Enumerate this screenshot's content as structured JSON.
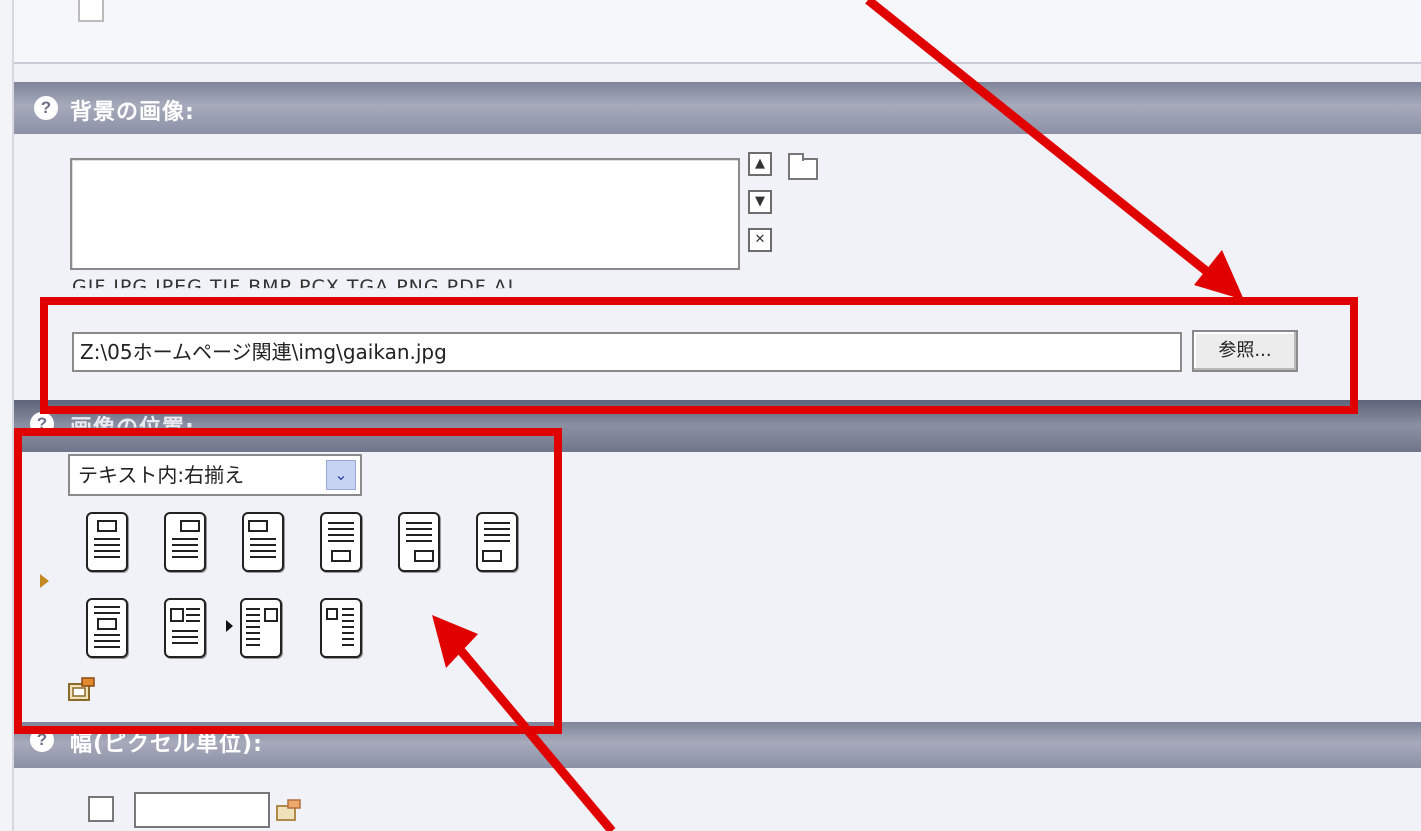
{
  "colors": {
    "annotation": "#e00000",
    "section_header": "#8d91a6",
    "panel_bg": "#f1f2f7"
  },
  "back_image_section": {
    "help_icon": "?",
    "label": "背景の画像:",
    "formats_text": "GIF,JPG,JPEG,TIF,BMP,PCX,TGA,PNG,PDF,AI",
    "file_path_value": "Z:\\05ホームページ関連\\img\\gaikan.jpg",
    "browse_label": "参照..."
  },
  "list_buttons": {
    "up": "▲",
    "down": "▼",
    "remove": "✕"
  },
  "position_section": {
    "help_icon": "?",
    "label": "画像の位置:",
    "align_select_value": "テキスト内:右揃え",
    "select_arrow": "⌄"
  },
  "layout_options": {
    "row1": [
      "top-center",
      "top-right",
      "top-left",
      "bottom-center",
      "bottom-right",
      "bottom-left"
    ],
    "row2": [
      "text-center",
      "text-left",
      "text-right-selected",
      "text-right"
    ],
    "selected": "text-right-selected"
  },
  "width_section": {
    "help_icon": "?",
    "label": "幅(ピクセル単位):"
  }
}
